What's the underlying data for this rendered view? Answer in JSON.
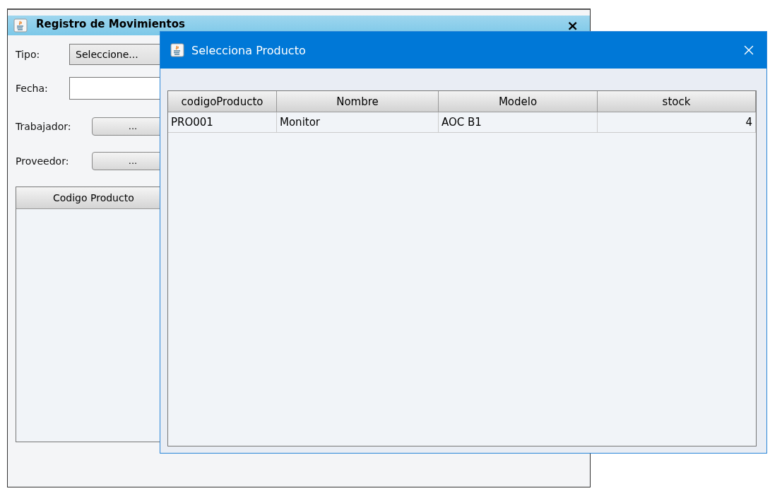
{
  "main_window": {
    "title": "Registro de Movimientos",
    "close": "×",
    "fields": [
      {
        "kind": "combo",
        "label": "Tipo:",
        "value": "Seleccione..."
      },
      {
        "kind": "text",
        "label": "Fecha:"
      },
      {
        "kind": "button",
        "label": "Trabajador:",
        "value": "..."
      },
      {
        "kind": "button",
        "label": "Proveedor:",
        "value": "..."
      }
    ],
    "table": {
      "columns": [
        "Codigo Producto"
      ]
    }
  },
  "dialog": {
    "title": "Selecciona Producto",
    "table": {
      "columns": [
        {
          "label": "codigoProducto",
          "kind": "text"
        },
        {
          "label": "Nombre",
          "kind": "text"
        },
        {
          "label": "Modelo",
          "kind": "text"
        },
        {
          "label": "stock",
          "kind": "number"
        }
      ],
      "rows": [
        [
          "PRO001",
          "Monitor",
          "AOC B1",
          "4"
        ]
      ]
    }
  }
}
